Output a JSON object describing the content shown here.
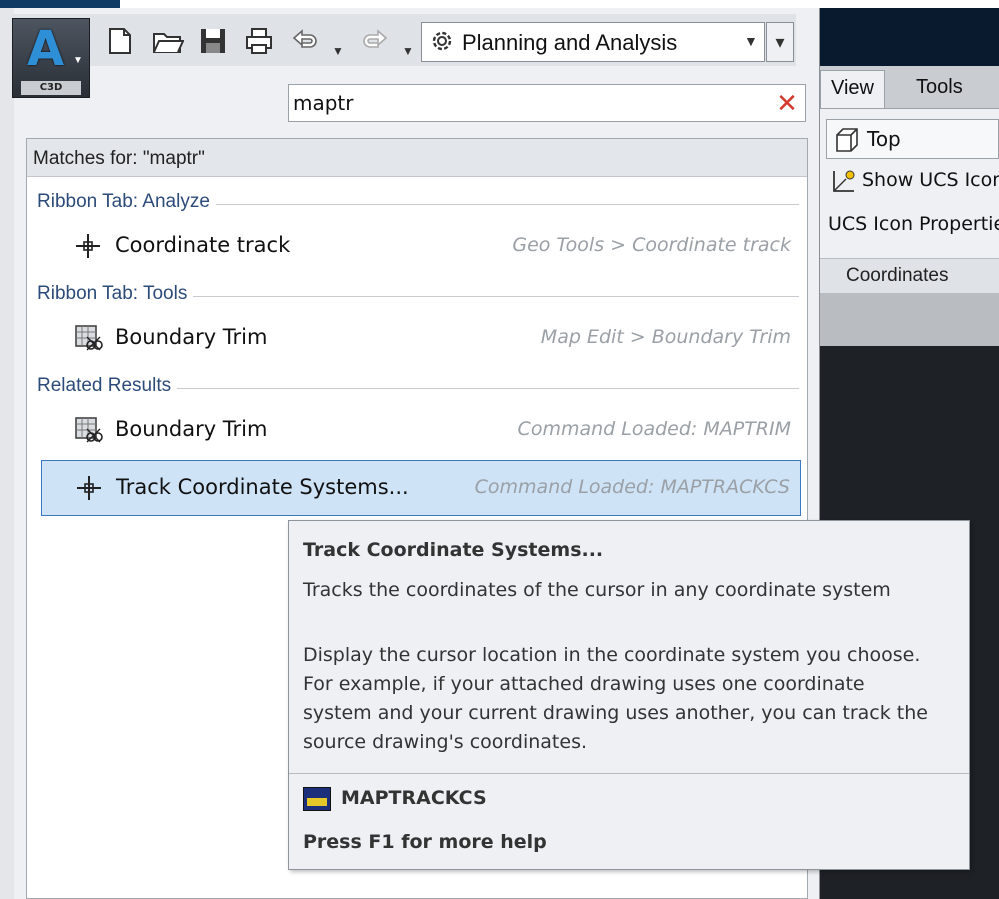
{
  "app": {
    "badge": "C3D",
    "letter": "A"
  },
  "qat": {
    "workspace": "Planning and Analysis"
  },
  "search": {
    "value": "maptr"
  },
  "results": {
    "header": "Matches for: \"maptr\"",
    "groups": [
      {
        "label": "Ribbon Tab: Analyze",
        "items": [
          {
            "label": "Coordinate track",
            "path": "Geo Tools > Coordinate track",
            "icon": "crosshair-icon"
          }
        ]
      },
      {
        "label": "Ribbon Tab: Tools",
        "items": [
          {
            "label": "Boundary Trim",
            "path": "Map Edit > Boundary Trim",
            "icon": "boundary-trim-icon"
          }
        ]
      },
      {
        "label": "Related Results",
        "items": [
          {
            "label": "Boundary Trim",
            "path": "Command Loaded: MAPTRIM",
            "icon": "boundary-trim-icon"
          },
          {
            "label": "Track Coordinate Systems...",
            "path": "Command Loaded: MAPTRACKCS",
            "icon": "crosshair-icon"
          }
        ]
      }
    ]
  },
  "ribbon": {
    "tabs": [
      "View",
      "Tools"
    ],
    "rows": [
      "Top",
      "Show UCS Icon",
      "UCS Icon Properties"
    ],
    "group_label": "Coordinates"
  },
  "tooltip": {
    "title": "Track Coordinate Systems...",
    "summary": "Tracks the coordinates of the cursor in any coordinate system",
    "body_lines": [
      "Display the cursor location in the coordinate system you choose.",
      "For example, if your attached drawing uses one coordinate",
      "system and your current drawing uses another, you can track the",
      "source drawing's coordinates."
    ],
    "command": "MAPTRACKCS",
    "help": "Press F1 for more help"
  },
  "colors": {
    "selection_fill": "#cfe3f7",
    "selection_border": "#3a78c2",
    "group_label": "#2d4b7a",
    "clear_icon": "#d43a2f"
  }
}
